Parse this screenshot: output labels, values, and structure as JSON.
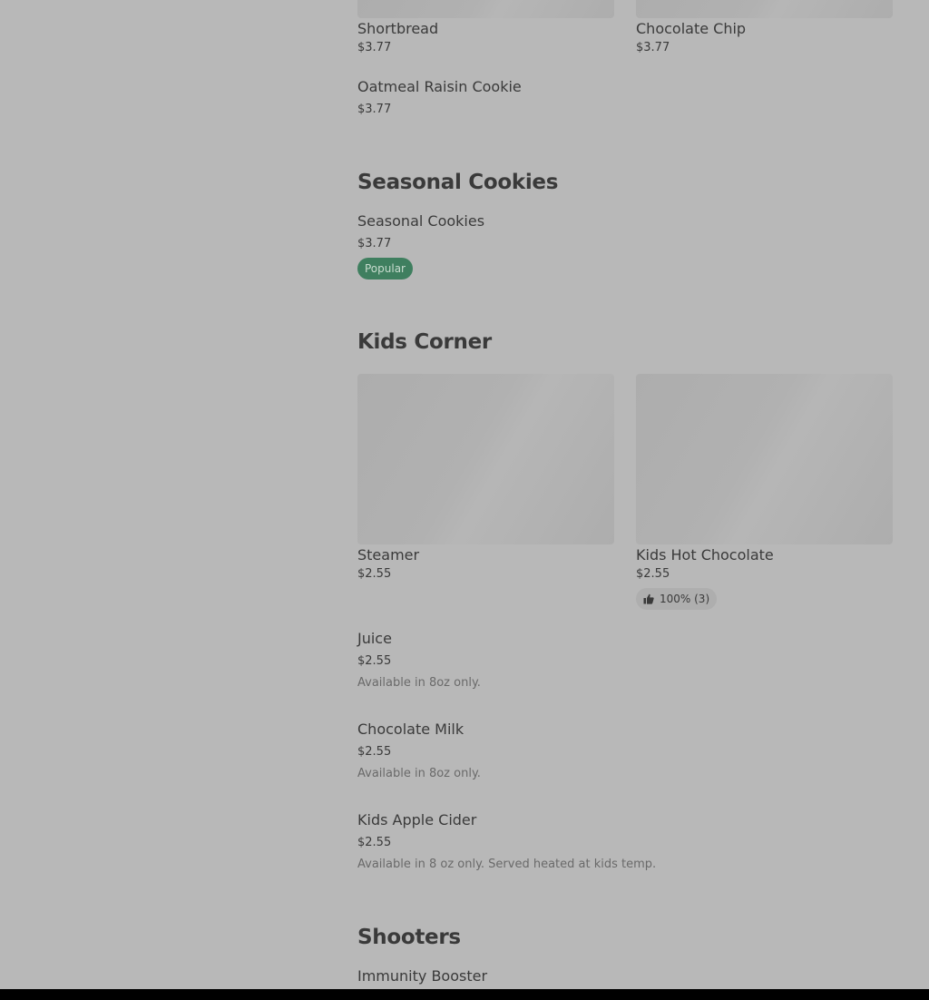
{
  "colors": {
    "background": "#b8b8b8",
    "popular_badge": "#3f7f5f",
    "text": "#3a3a3a",
    "muted_text": "#6a6a6a"
  },
  "top_items": [
    {
      "name": "Shortbread",
      "price": "$3.77"
    },
    {
      "name": "Chocolate Chip",
      "price": "$3.77"
    },
    {
      "name": "Oatmeal Raisin Cookie",
      "price": "$3.77"
    }
  ],
  "seasonal": {
    "title": "Seasonal Cookies",
    "items": [
      {
        "name": "Seasonal Cookies",
        "price": "$3.77",
        "badge": "Popular"
      }
    ]
  },
  "kids": {
    "title": "Kids Corner",
    "items": [
      {
        "name": "Steamer",
        "price": "$2.55"
      },
      {
        "name": "Kids Hot Chocolate",
        "price": "$2.55",
        "rating": "100% (3)",
        "rating_icon": "thumbs-up-icon"
      },
      {
        "name": "Juice",
        "price": "$2.55",
        "description": "Available in 8oz only."
      },
      {
        "name": "Chocolate Milk",
        "price": "$2.55",
        "description": "Available in 8oz only."
      },
      {
        "name": "Kids Apple Cider",
        "price": "$2.55",
        "description": "Available in 8 oz only. Served heated at kids temp."
      }
    ]
  },
  "shooters": {
    "title": "Shooters",
    "items": [
      {
        "name": "Immunity Booster"
      }
    ]
  }
}
